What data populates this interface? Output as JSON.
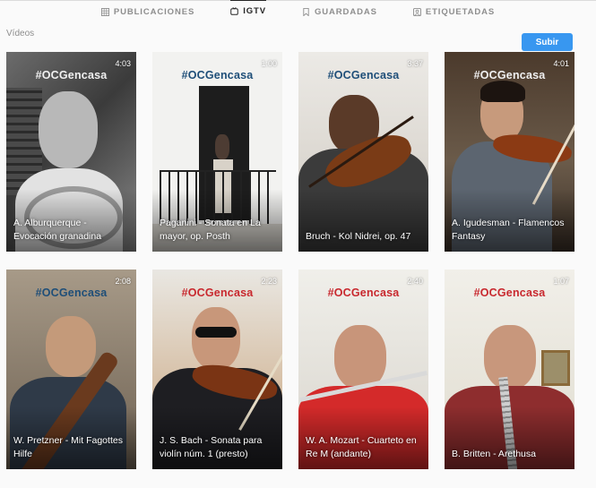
{
  "tabs": [
    {
      "label": "PUBLICACIONES",
      "icon": "grid-icon",
      "active": false
    },
    {
      "label": "IGTV",
      "icon": "igtv-icon",
      "active": true
    },
    {
      "label": "GUARDADAS",
      "icon": "bookmark-icon",
      "active": false
    },
    {
      "label": "ETIQUETADAS",
      "icon": "tagged-icon",
      "active": false
    }
  ],
  "section": {
    "label": "Vídeos"
  },
  "upload_button": {
    "label": "Subir",
    "color": "#3897f0"
  },
  "hashtag": "#OCGencasa",
  "videos": [
    {
      "duration": "4:03",
      "title": "A. Alburquerque - Evocación granadina",
      "hashtag_color": "white"
    },
    {
      "duration": "1:00",
      "title": "Paganini - Sonata en La mayor, op. Posth",
      "hashtag_color": "blue"
    },
    {
      "duration": "3:37",
      "title": "Bruch - Kol Nidrei, op. 47",
      "hashtag_color": "blue"
    },
    {
      "duration": "4:01",
      "title": "A. Igudesman - Flamencos Fantasy",
      "hashtag_color": "white"
    },
    {
      "duration": "2:08",
      "title": "W. Pretzner - Mit Fagottes Hilfe",
      "hashtag_color": "blue"
    },
    {
      "duration": "2:23",
      "title": "J. S. Bach - Sonata para violín núm. 1 (presto)",
      "hashtag_color": "red"
    },
    {
      "duration": "2:40",
      "title": "W. A. Mozart - Cuarteto en Re M (andante)",
      "hashtag_color": "red"
    },
    {
      "duration": "1:07",
      "title": "B. Britten - Arethusa",
      "hashtag_color": "red"
    }
  ]
}
